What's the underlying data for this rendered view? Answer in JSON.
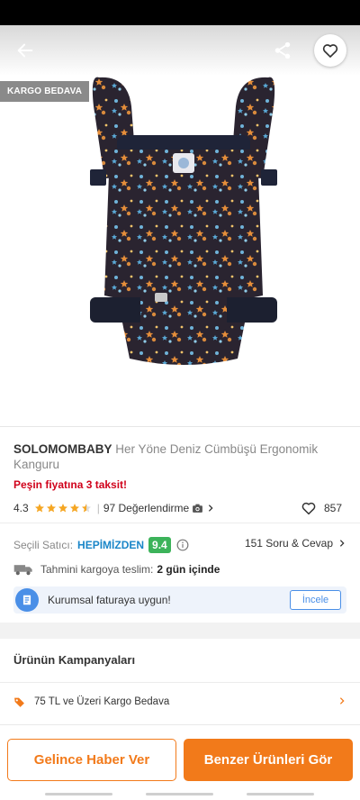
{
  "header": {
    "cargo_badge": "KARGO BEDAVA",
    "back_icon": "arrow-left-icon",
    "share_icon": "share-icon",
    "favorite_icon": "heart-outline-icon"
  },
  "product": {
    "brand": "SOLOMOMBABY",
    "name": "Her Yöne Deniz Cümbüşü Ergonomik Kanguru",
    "installment": "Peşin fiyatına 3 taksit!",
    "rating": "4.3",
    "rating_stars": 4.3,
    "reviews": "97 Değerlendirme",
    "favorites": "857"
  },
  "seller": {
    "label": "Seçili Satıcı:",
    "name": "HEPİMİZDEN",
    "score": "9.4",
    "qa": "151 Soru & Cevap"
  },
  "shipping": {
    "label": "Tahmini kargoya teslim:",
    "value": "2 gün içinde"
  },
  "invoice": {
    "text": "Kurumsal faturaya uygun!",
    "button": "İncele"
  },
  "campaigns": {
    "title": "Ürünün Kampanyaları",
    "items": [
      {
        "label": "75 TL ve Üzeri Kargo Bedava"
      }
    ]
  },
  "actions": {
    "notify": "Gelince Haber Ver",
    "similar": "Benzer Ürünleri Gör"
  },
  "colors": {
    "accent": "#f27a1a",
    "seller_blue": "#1a86c8",
    "score_green": "#3cb35a",
    "installment_red": "#d0021b",
    "star": "#f5a623"
  }
}
